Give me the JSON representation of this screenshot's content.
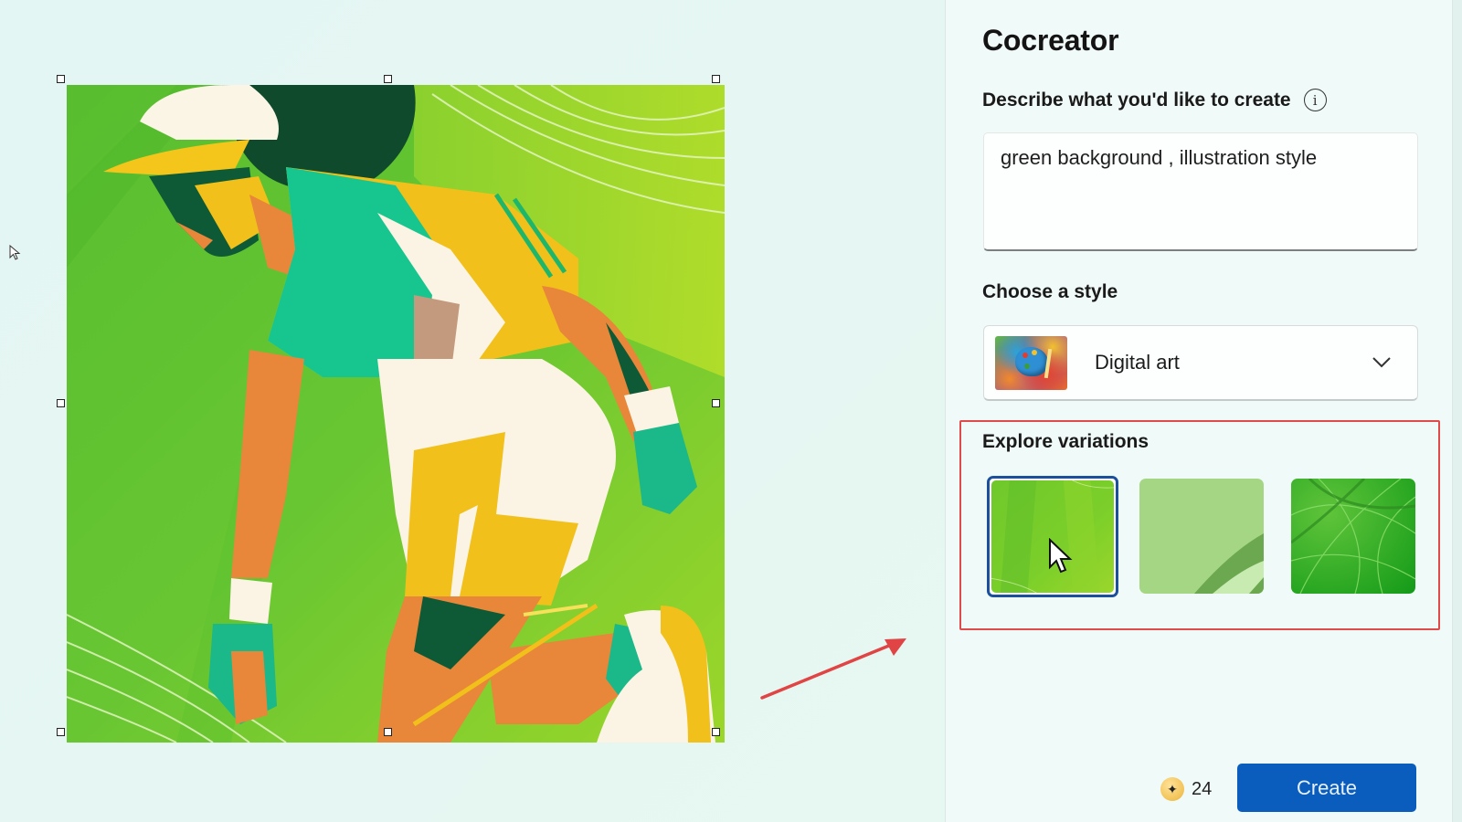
{
  "panel": {
    "title": "Cocreator",
    "describe_label": "Describe what you'd like to create",
    "info_icon": "info-icon",
    "prompt_value": "green background , illustration style",
    "style_label": "Choose a style",
    "style_selected": "Digital art",
    "style_icon": "palette-thumbnail",
    "variations_label": "Explore variations",
    "variations": [
      {
        "name": "variation-1",
        "selected": true,
        "description": "bright green diagonal streaks"
      },
      {
        "name": "variation-2",
        "selected": false,
        "description": "pale green with curved band"
      },
      {
        "name": "variation-3",
        "selected": false,
        "description": "green swirling lines"
      }
    ],
    "credits_icon": "sparkle-coin-icon",
    "credits_count": "24",
    "create_label": "Create"
  },
  "canvas": {
    "artwork": "illustration of golfer in green background",
    "selection_handles": 8
  },
  "colors": {
    "accent_blue": "#0a5dbd",
    "selected_border": "#1c4f9c",
    "highlight_red": "#e04a4a",
    "panel_bg": "#f0faf8",
    "page_bg": "#e4f6f3"
  }
}
